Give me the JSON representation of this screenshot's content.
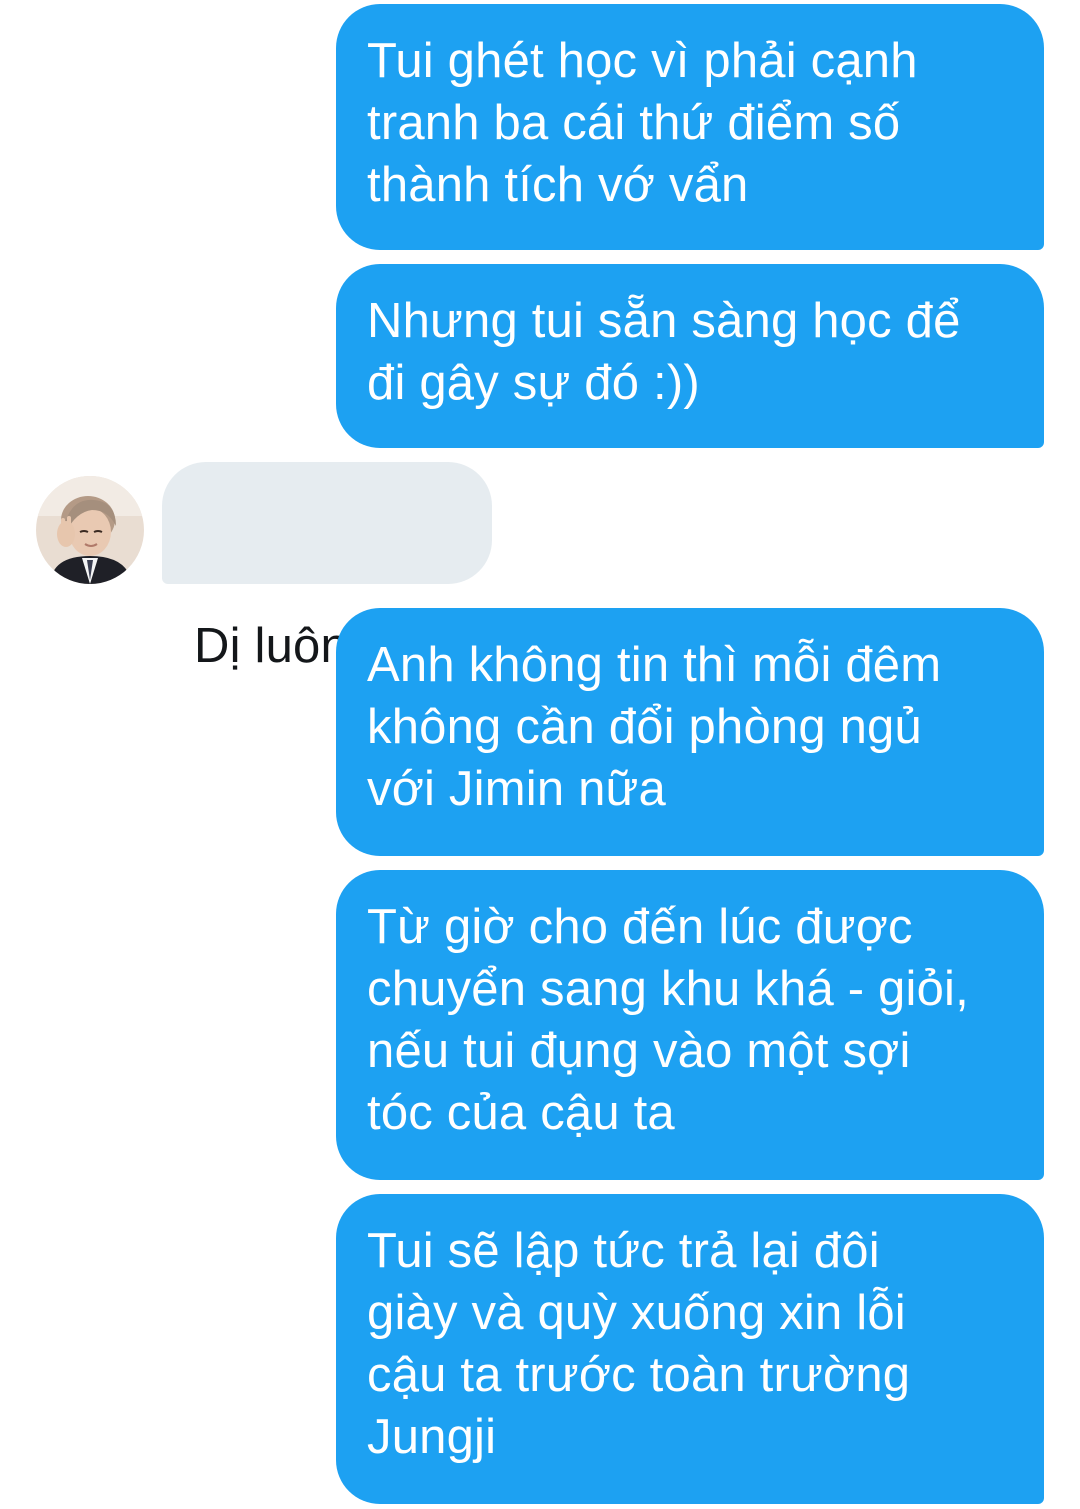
{
  "conversation": {
    "messages": [
      {
        "sender": "me",
        "text": "Tui ghét học vì phải cạnh\ntranh ba cái thứ điểm số\nthành tích vớ vẩn"
      },
      {
        "sender": "me",
        "text": "Nhưng tui sẵn sàng học để\nđi gây sự đó :))"
      },
      {
        "sender": "other",
        "text": "Dị luôn?",
        "emoji": "eyes-emoji"
      },
      {
        "sender": "me",
        "text": "Anh không tin thì mỗi đêm\nkhông cần đổi phòng ngủ\nvới Jimin nữa"
      },
      {
        "sender": "me",
        "text": "Từ giờ cho đến lúc được\nchuyển sang khu khá - giỏi,\nnếu tui đụng vào một sợi\ntóc của cậu ta"
      },
      {
        "sender": "me",
        "text": "Tui sẽ lập tức trả lại đôi\ngiày và quỳ xuống xin lỗi\ncậu ta trước toàn trường\nJungji"
      }
    ]
  },
  "colors": {
    "sent_bubble": "#1da1f2",
    "received_bubble": "#e6ecf0",
    "sent_text": "#ffffff",
    "received_text": "#14171a"
  },
  "icons": {
    "avatar": "profile-photo",
    "emoji": "eyes-emoji"
  }
}
